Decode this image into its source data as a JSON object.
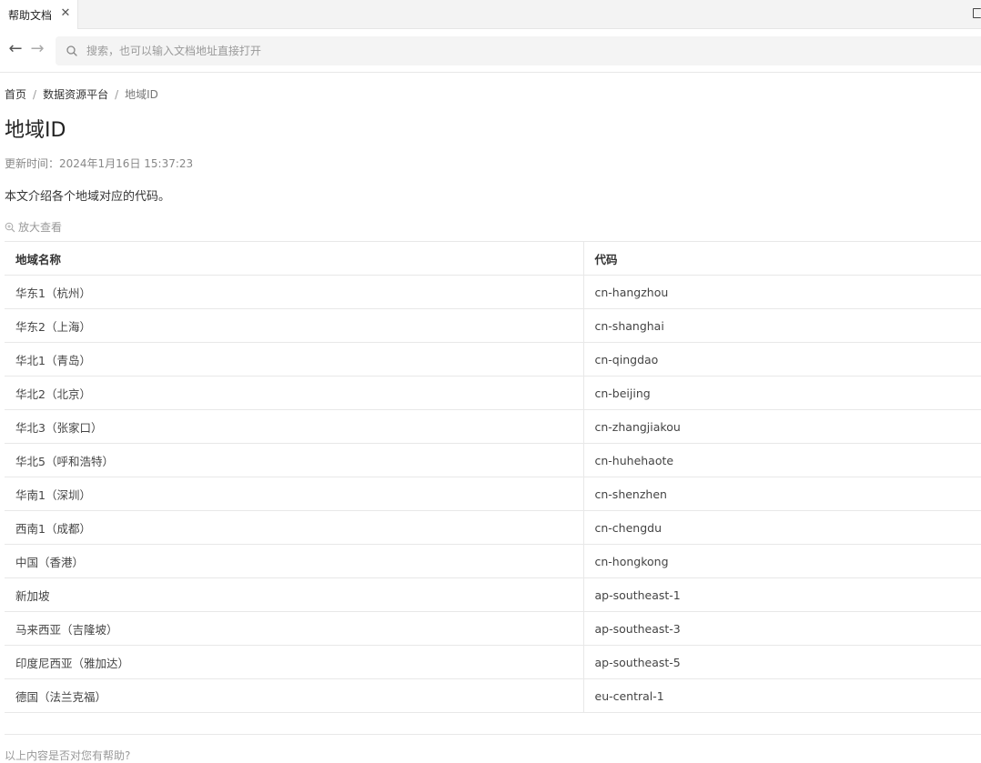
{
  "tab": {
    "title": "帮助文档",
    "close_icon": "close-icon"
  },
  "nav": {
    "back_icon": "arrow-left-icon",
    "forward_icon": "arrow-right-icon"
  },
  "search": {
    "placeholder": "搜索，也可以输入文档地址直接打开",
    "value": ""
  },
  "breadcrumb": {
    "items": [
      "首页",
      "数据资源平台",
      "地域ID"
    ],
    "separator": "/"
  },
  "page": {
    "title": "地域ID",
    "update_time": "更新时间：2024年1月16日 15:37:23",
    "intro": "本文介绍各个地域对应的代码。",
    "zoom_label": "放大查看"
  },
  "table": {
    "headers": [
      "地域名称",
      "代码"
    ],
    "rows": [
      [
        "华东1（杭州）",
        "cn-hangzhou"
      ],
      [
        "华东2（上海）",
        "cn-shanghai"
      ],
      [
        "华北1（青岛）",
        "cn-qingdao"
      ],
      [
        "华北2（北京）",
        "cn-beijing"
      ],
      [
        "华北3（张家口）",
        "cn-zhangjiakou"
      ],
      [
        "华北5（呼和浩特）",
        "cn-huhehaote"
      ],
      [
        "华南1（深圳）",
        "cn-shenzhen"
      ],
      [
        "西南1（成都）",
        "cn-chengdu"
      ],
      [
        "中国（香港）",
        "cn-hongkong"
      ],
      [
        "新加坡",
        "ap-southeast-1"
      ],
      [
        "马来西亚（吉隆坡）",
        "ap-southeast-3"
      ],
      [
        "印度尼西亚（雅加达）",
        "ap-southeast-5"
      ],
      [
        "德国（法兰克福）",
        "eu-central-1"
      ]
    ]
  },
  "footer": {
    "feedback_text": "以上内容是否对您有帮助?"
  },
  "colors": {
    "tabbar_bg": "#f3f3f3",
    "search_bg": "#f4f4f4",
    "border": "#e8e8e8"
  }
}
